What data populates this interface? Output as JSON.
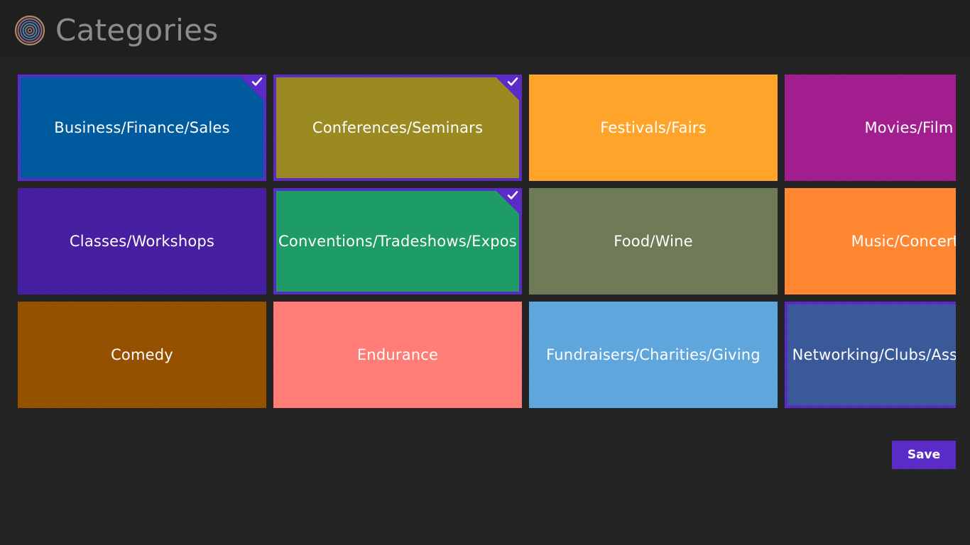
{
  "header": {
    "title": "Categories",
    "logo_icon": "concentric-rings-logo-icon"
  },
  "colors": {
    "selection": "#5b2bc8",
    "header_bg": "#1f1f1f",
    "page_bg": "#232323"
  },
  "categories": [
    {
      "label": "Business/Finance/Sales",
      "color": "#005a9e",
      "selected": true
    },
    {
      "label": "Classes/Workshops",
      "color": "#4620a0",
      "selected": false
    },
    {
      "label": "Comedy",
      "color": "#965100",
      "selected": false
    },
    {
      "label": "Conferences/Seminars",
      "color": "#9b8a22",
      "selected": true
    },
    {
      "label": "Conventions/Tradeshows/Expos",
      "color": "#1e9c66",
      "selected": true
    },
    {
      "label": "Endurance",
      "color": "#ff7d76",
      "selected": false
    },
    {
      "label": "Festivals/Fairs",
      "color": "#ffa42a",
      "selected": false
    },
    {
      "label": "Food/Wine",
      "color": "#6f7b56",
      "selected": false
    },
    {
      "label": "Fundraisers/Charities/Giving",
      "color": "#5ea6dc",
      "selected": false
    },
    {
      "label": "Movies/Film",
      "color": "#a21e8e",
      "selected": false
    },
    {
      "label": "Music/Concerts",
      "color": "#ff8731",
      "selected": false
    },
    {
      "label": "Networking/Clubs/Associations",
      "color": "#395999",
      "selected": true
    }
  ],
  "actions": {
    "save_label": "Save"
  }
}
